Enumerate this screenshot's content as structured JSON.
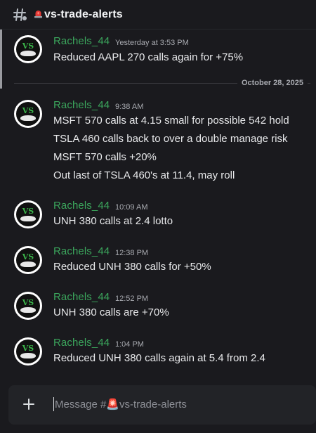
{
  "header": {
    "channel_icon": "siren-icon",
    "channel_name": "vs-trade-alerts"
  },
  "date_divider": "October 28, 2025",
  "messages": [
    {
      "username": "Rachels_44",
      "timestamp": "Yesterday at 3:53 PM",
      "lines": [
        "Reduced AAPL 270 calls again for +75%"
      ]
    },
    {
      "username": "Rachels_44",
      "timestamp": "9:38 AM",
      "lines": [
        "MSFT 570 calls at 4.15 small for possible 542 hold",
        "TSLA 460 calls back to over a double manage risk",
        "MSFT 570 calls +20%",
        "Out last of TSLA 460's at 11.4, may roll"
      ]
    },
    {
      "username": "Rachels_44",
      "timestamp": "10:09 AM",
      "lines": [
        "UNH 380 calls at 2.4 lotto"
      ]
    },
    {
      "username": "Rachels_44",
      "timestamp": "12:38 PM",
      "lines": [
        "Reduced UNH 380 calls for +50%"
      ]
    },
    {
      "username": "Rachels_44",
      "timestamp": "12:52 PM",
      "lines": [
        "UNH 380 calls are +70%"
      ]
    },
    {
      "username": "Rachels_44",
      "timestamp": "1:04 PM",
      "lines": [
        "Reduced UNH 380 calls again at 5.4 from 2.4"
      ]
    }
  ],
  "composer": {
    "placeholder": "Message #🚨vs-trade-alerts"
  },
  "avatar_text": "VS",
  "colors": {
    "background": "#1a1a1e",
    "username": "#3ba55c",
    "text": "#e8e9eb",
    "muted": "#a9abb1"
  }
}
